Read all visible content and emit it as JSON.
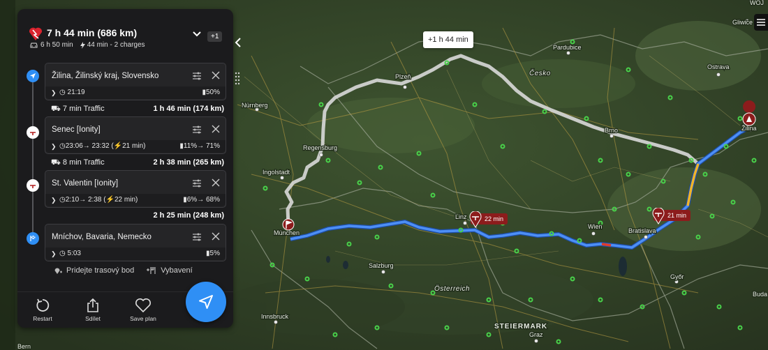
{
  "summary": {
    "title": "7 h 44 min (686 km)",
    "drive_time": "6 h 50 min",
    "charge_info": "44 min - 2 charges",
    "extra_badge": "+1"
  },
  "waypoints": [
    {
      "name": "Žilina, Žilinský kraj, Slovensko",
      "time": "21:19",
      "battery": "50%",
      "type": "start"
    },
    {
      "name": "Senec [Ionity]",
      "time": "23:06→ 23:32 (⚡21 min)",
      "battery": "11%→ 71%",
      "type": "charger"
    },
    {
      "name": "St. Valentin [Ionity]",
      "time": "2:10→ 2:38 (⚡22 min)",
      "battery": "6%→ 68%",
      "type": "charger"
    },
    {
      "name": "Mníchov, Bavaria, Nemecko",
      "time": "5:03",
      "battery": "5%",
      "type": "destination"
    }
  ],
  "segments": [
    {
      "traffic": "7 min Traffic",
      "duration": "1 h 46 min (174 km)"
    },
    {
      "traffic": "8 min Traffic",
      "duration": "2 h 38 min (265 km)"
    },
    {
      "traffic": "",
      "duration": "2 h 25 min (248 km)"
    }
  ],
  "actions": {
    "add_waypoint": "Pridejte trasový bod",
    "amenities": "Vybavení"
  },
  "footer": {
    "restart": "Restart",
    "share": "Sdílet",
    "save": "Save plan"
  },
  "map": {
    "alt_route_callout": "+1 h 44 min",
    "charge_pin_1": "22 min",
    "charge_pin_2": "21 min",
    "labels": {
      "nurnberg": "Nürnberg",
      "plzen": "Plzeň",
      "pardubice": "Pardubice",
      "cesko": "Česko",
      "ostrava": "Ostrava",
      "gliwice": "Gliwice",
      "brno": "Brno",
      "regensburg": "Regensburg",
      "ingolstadt": "Ingolstadt",
      "munchen": "München",
      "linz": "Linz",
      "salzburg": "Salzburg",
      "osterreich": "Österreich",
      "wien": "Wien",
      "bratislava": "Bratislava",
      "zilina": "Žilina",
      "gyor": "Győr",
      "innsbruck": "Innsbruck",
      "steiermark": "STEIERMARK",
      "graz": "Graz",
      "bern": "Bern",
      "buda": "Buda",
      "woj": "WOJ"
    }
  },
  "colors": {
    "route": "#3b7cf0",
    "alt_route": "#d9d9d9",
    "accent": "#2f8ff5",
    "pin": "#8c1c1c"
  }
}
